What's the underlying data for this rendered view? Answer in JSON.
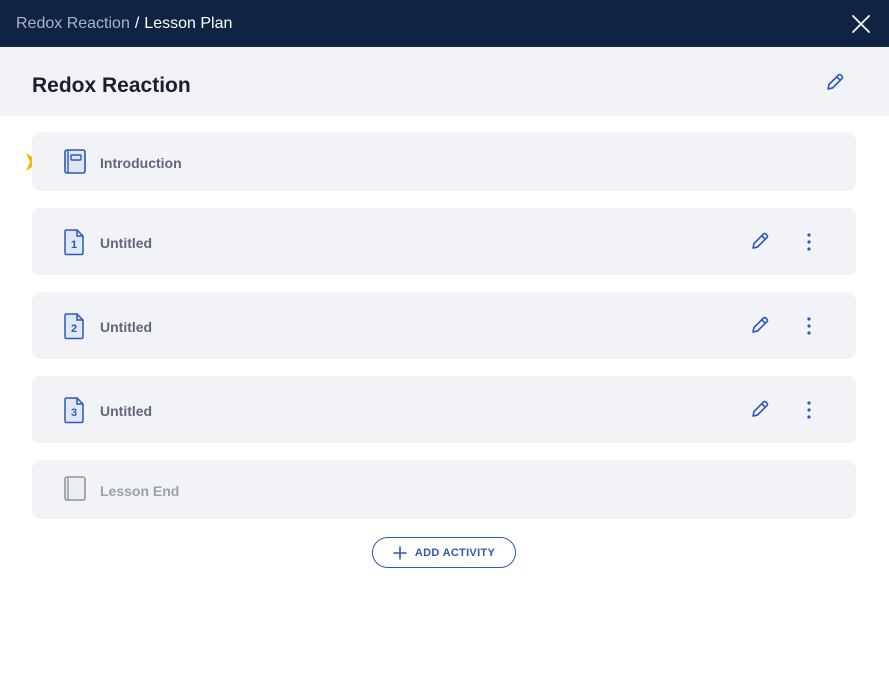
{
  "breadcrumb": {
    "parent": "Redox Reaction",
    "separator": "/",
    "current": "Lesson Plan"
  },
  "header": {
    "title": "Redox Reaction"
  },
  "activities": [
    {
      "label": "Introduction",
      "icon": "book-icon",
      "current": true
    },
    {
      "label": "Untitled",
      "number": "1",
      "icon": "numbered-document-icon"
    },
    {
      "label": "Untitled",
      "number": "2",
      "icon": "numbered-document-icon"
    },
    {
      "label": "Untitled",
      "number": "3",
      "icon": "numbered-document-icon"
    },
    {
      "label": "Lesson End",
      "icon": "book-end-icon",
      "disabled": true
    }
  ],
  "add_activity": {
    "label": "ADD ACTIVITY"
  },
  "colors": {
    "titlebar": "#0f2442",
    "accent": "#2c59b5",
    "pointer": "#f5b800",
    "card": "#f2f3f7"
  }
}
